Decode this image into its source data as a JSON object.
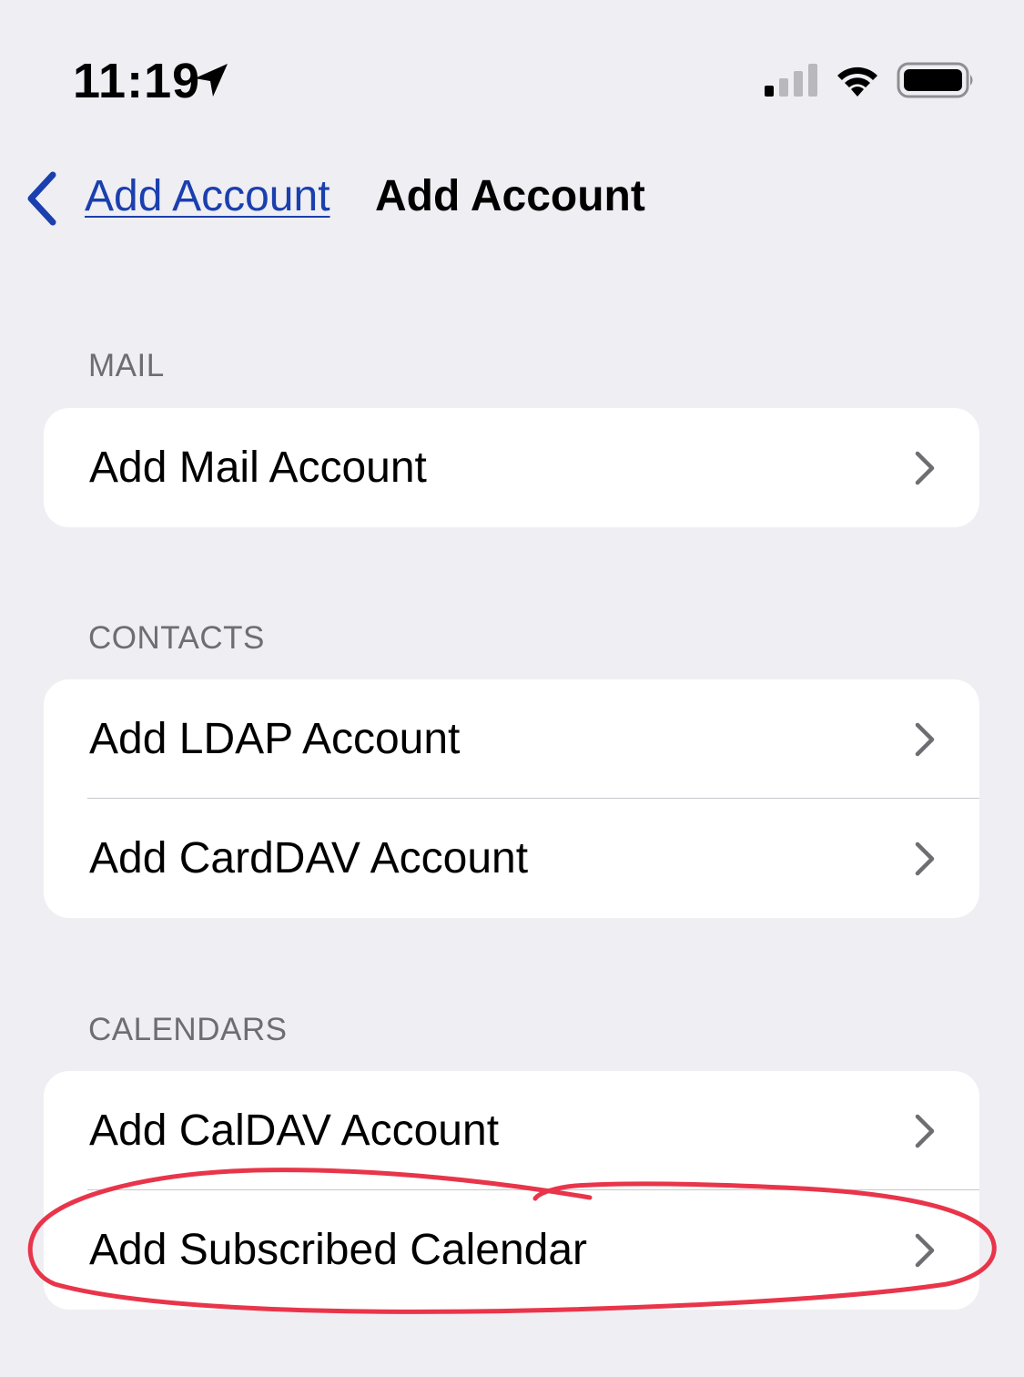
{
  "status_bar": {
    "time": "11:19",
    "icons": [
      "location-arrow-icon",
      "cellular-signal-icon",
      "wifi-icon",
      "battery-icon"
    ]
  },
  "nav": {
    "back_label": "Add Account",
    "title": "Add Account",
    "accent_color": "#1a3fae"
  },
  "sections": {
    "mail": {
      "header": "MAIL",
      "items": [
        "Add Mail Account"
      ]
    },
    "contacts": {
      "header": "CONTACTS",
      "items": [
        "Add LDAP Account",
        "Add CardDAV Account"
      ]
    },
    "calendars": {
      "header": "CALENDARS",
      "items": [
        "Add CalDAV Account",
        "Add Subscribed Calendar"
      ]
    }
  },
  "annotation": {
    "color": "#e8354a",
    "highlighted_item": "Add Subscribed Calendar"
  }
}
